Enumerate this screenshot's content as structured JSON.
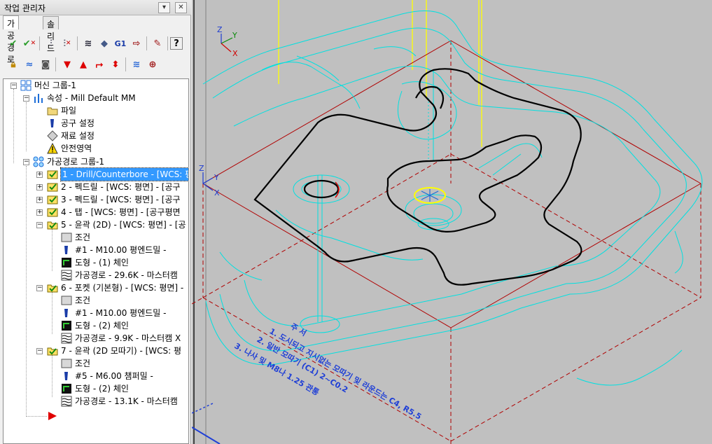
{
  "manager": {
    "title": "작업 관리자",
    "pin_label": "▾",
    "close_label": "✕",
    "tabs": [
      "가공경로",
      "솔리드"
    ],
    "toolbar1_icons": [
      "select-all-check-icon",
      "select-invalid-check-icon",
      "regenerate-icon",
      "regenerate-dirty-icon",
      "backplot-icon",
      "verify-icon",
      "post-g1-icon",
      "run-post-icon",
      "highfeed-icon",
      "help-icon"
    ],
    "toolbar2_icons": [
      "lock-icon",
      "toggle-display-icon",
      "toggle-posting-icon",
      "move-down-icon",
      "move-up-icon",
      "insert-arrow-icon",
      "scroll-icon",
      "display-icon",
      "single-operation-icon"
    ],
    "g1_label": "G1",
    "help_label": "?"
  },
  "tree": {
    "machine_group": "머신 그룹-1",
    "properties": "속성 - Mill Default MM",
    "prop_items": [
      "파일",
      "공구 설정",
      "재료 설정",
      "안전영역"
    ],
    "toolpath_group": "가공경로 그룹-1",
    "ops": [
      "1 - Drill/Counterbore - [WCS: 평",
      "2 - 펙드릴 - [WCS: 평면] - [공구",
      "3 - 펙드릴 - [WCS: 평면] - [공구",
      "4 - 탭 - [WCS: 평면] - [공구평면",
      "5 - 윤곽 (2D) - [WCS: 평면] - [공",
      "6 - 포켓 (기본형) - [WCS: 평면] -",
      "7 - 윤곽 (2D 모따기) - [WCS: 평"
    ],
    "op5_children": [
      "조건",
      "#1 - M10.00 평엔드밀 -",
      "도형 - (1) 체인",
      "가공경로 - 29.6K - 마스터캠"
    ],
    "op6_children": [
      "조건",
      "#1 - M10.00 평엔드밀 -",
      "도형 - (2) 체인",
      "가공경로 - 9.9K - 마스터캠 X"
    ],
    "op7_children": [
      "조건",
      "#5 - M6.00 챔퍼밀 -",
      "도형 - (2) 체인",
      "가공경로 - 13.1K - 마스터캠"
    ]
  },
  "viewport": {
    "axis_top": {
      "z": "Z",
      "y": "Y",
      "x": "X"
    },
    "axis_mid": {
      "z": "Z",
      "y": "Y",
      "x": "X"
    },
    "notes": [
      "주 서",
      "1. 도시되고 지시없는 모따기 및 라운드는 C4, R5.5",
      "2. 일반 모따기 (C1) 2~C0.2",
      "3. 나사 및 M8나 1.25 관통"
    ],
    "colors": {
      "background": "#c0c0c0",
      "geometry": "#000000",
      "toolpath": "#00e5e5",
      "stock": "#cc0000",
      "rapid": "#ffff00",
      "notes": "#1f3fd6"
    }
  }
}
